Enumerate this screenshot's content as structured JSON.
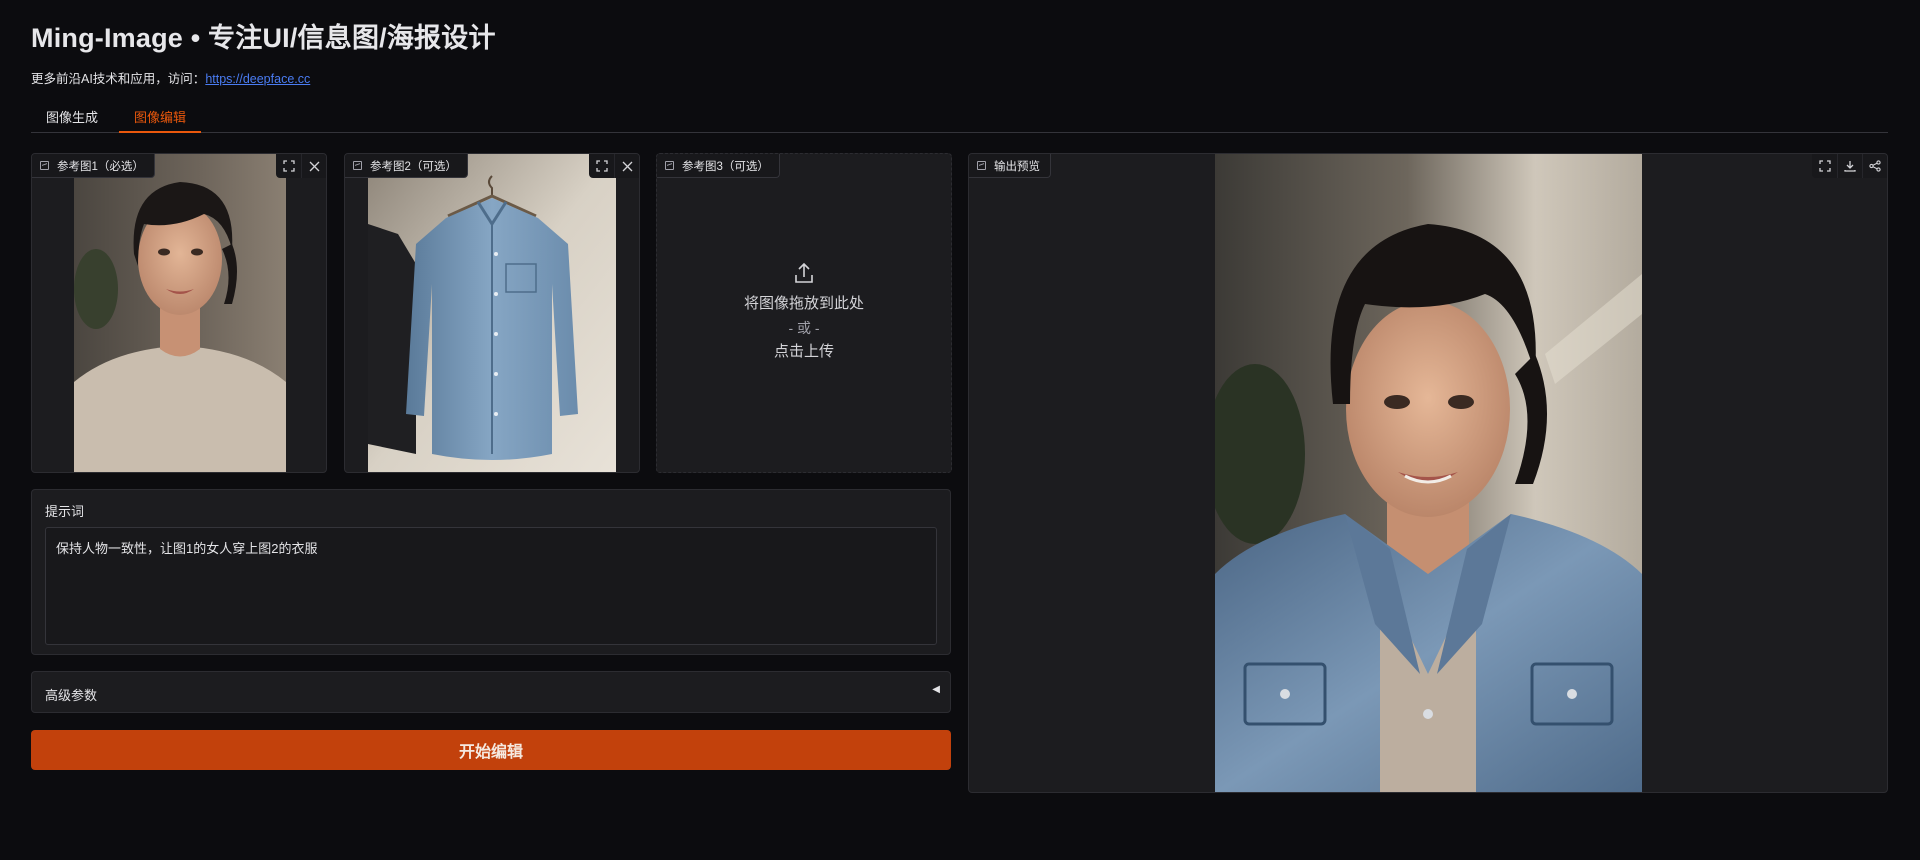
{
  "app": {
    "title": "Ming-Image • 专注UI/信息图/海报设计",
    "subtitle_prefix": "更多前沿AI技术和应用，访问：",
    "subtitle_link": "https://deepface.cc"
  },
  "tabs": [
    {
      "label": "图像生成",
      "active": false
    },
    {
      "label": "图像编辑",
      "active": true
    }
  ],
  "inputs": {
    "ref1": {
      "label": "参考图1（必选）",
      "image": "woman-portrait-photo"
    },
    "ref2": {
      "label": "参考图2（可选）",
      "image": "denim-shirt-on-hanger-photo"
    },
    "ref3": {
      "label": "参考图3（可选）",
      "drop_text": "将图像拖放到此处",
      "or_text": "- 或 -",
      "click_text": "点击上传"
    }
  },
  "prompt": {
    "label": "提示词",
    "value": "保持人物一致性，让图1的女人穿上图2的衣服"
  },
  "advanced": {
    "label": "高级参数",
    "arrow": "◀"
  },
  "run_button": {
    "label": "开始编辑"
  },
  "output": {
    "label": "输出预览",
    "image": "woman-in-denim-jacket-photo"
  },
  "icons": {
    "fullscreen": "fullscreen-icon",
    "close": "close-icon",
    "download": "download-icon",
    "share": "share-icon",
    "upload": "upload-icon"
  },
  "colors": {
    "accent": "#ea580c",
    "button": "#c2410c",
    "background": "#0c0c0f",
    "panel": "#1c1c1f",
    "link": "#4a7cf2"
  }
}
